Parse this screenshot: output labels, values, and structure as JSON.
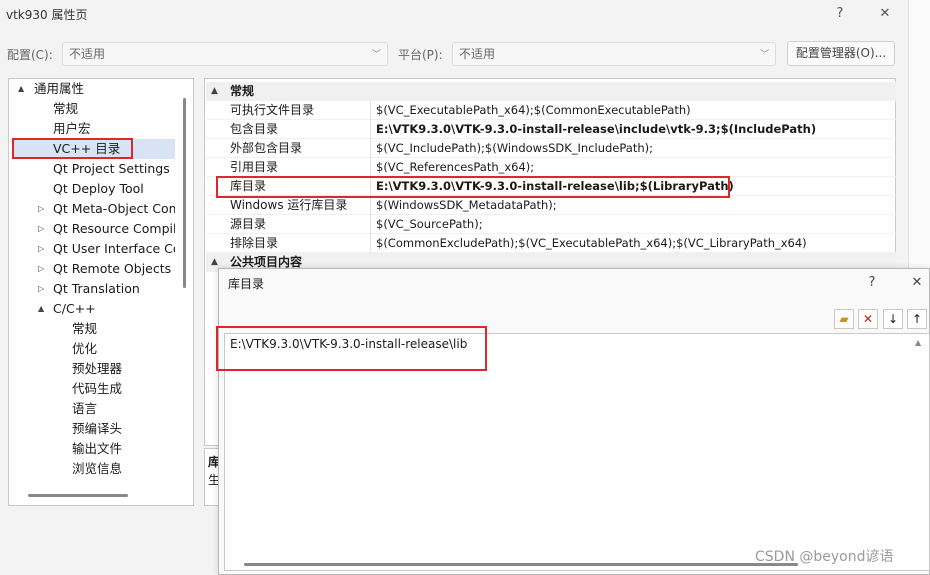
{
  "window": {
    "title": "vtk930 属性页",
    "help_label": "?",
    "close_label": "✕"
  },
  "toolbar": {
    "config_label": "配置(C):",
    "config_value": "不适用",
    "platform_label": "平台(P):",
    "platform_value": "不适用",
    "config_manager_label": "配置管理器(O)..."
  },
  "tree": {
    "items": [
      {
        "label": "通用属性",
        "arrow": "▲"
      },
      {
        "label": "常规"
      },
      {
        "label": "用户宏"
      },
      {
        "label": "VC++ 目录"
      },
      {
        "label": "Qt Project Settings"
      },
      {
        "label": "Qt Deploy Tool"
      },
      {
        "label": "Qt Meta-Object Com",
        "arrow": "▷"
      },
      {
        "label": "Qt Resource Compile",
        "arrow": "▷"
      },
      {
        "label": "Qt User Interface Co",
        "arrow": "▷"
      },
      {
        "label": "Qt Remote Objects C",
        "arrow": "▷"
      },
      {
        "label": "Qt Translation",
        "arrow": "▷"
      },
      {
        "label": "C/C++",
        "arrow": "▲"
      },
      {
        "label": "常规"
      },
      {
        "label": "优化"
      },
      {
        "label": "预处理器"
      },
      {
        "label": "代码生成"
      },
      {
        "label": "语言"
      },
      {
        "label": "预编译头"
      },
      {
        "label": "输出文件"
      },
      {
        "label": "浏览信息"
      }
    ]
  },
  "grid": {
    "category_general": "常规",
    "category_public": "公共项目内容",
    "rows": [
      {
        "name": "可执行文件目录",
        "value": "$(VC_ExecutablePath_x64);$(CommonExecutablePath)"
      },
      {
        "name": "包含目录",
        "value": "E:\\VTK9.3.0\\VTK-9.3.0-install-release\\include\\vtk-9.3;$(IncludePath)"
      },
      {
        "name": "外部包含目录",
        "value": "$(VC_IncludePath);$(WindowsSDK_IncludePath);"
      },
      {
        "name": "引用目录",
        "value": "$(VC_ReferencesPath_x64);"
      },
      {
        "name": "库目录",
        "value": "E:\\VTK9.3.0\\VTK-9.3.0-install-release\\lib;$(LibraryPath)"
      },
      {
        "name": "Windows 运行库目录",
        "value": "$(WindowsSDK_MetadataPath);"
      },
      {
        "name": "源目录",
        "value": "$(VC_SourcePath);"
      },
      {
        "name": "排除目录",
        "value": "$(CommonExcludePath);$(VC_ExecutablePath_x64);$(VC_LibraryPath_x64)"
      }
    ],
    "desc_title": "库",
    "desc_text": "生"
  },
  "dialog": {
    "title": "库目录",
    "help_label": "?",
    "close_label": "✕",
    "items": [
      "E:\\VTK9.3.0\\VTK-9.3.0-install-release\\lib"
    ]
  },
  "watermark": "CSDN @beyond谚语"
}
